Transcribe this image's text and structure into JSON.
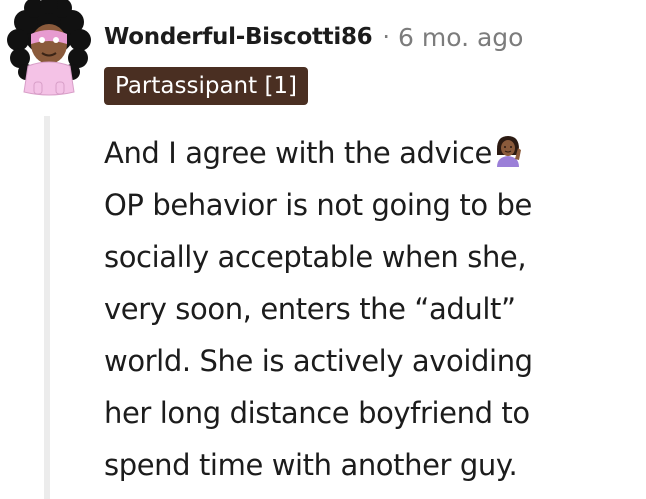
{
  "comment": {
    "author": "Wonderful-Biscotti86",
    "separator": "·",
    "timestamp": "6 mo. ago",
    "flair": "Partassipant [1]",
    "body_lines": [
      "And I agree with the advice",
      "OP behavior is not going to be",
      "socially acceptable when she,",
      "very soon, enters the “adult”",
      "world. She is actively avoiding",
      "her long distance boyfriend to",
      "spend time with another guy."
    ],
    "inline_emoji": "woman-tipping-hand-emoji"
  },
  "colors": {
    "flair_bg": "#4a2f22",
    "meta_text": "#7c7c7c",
    "thread_line": "#ececec"
  }
}
